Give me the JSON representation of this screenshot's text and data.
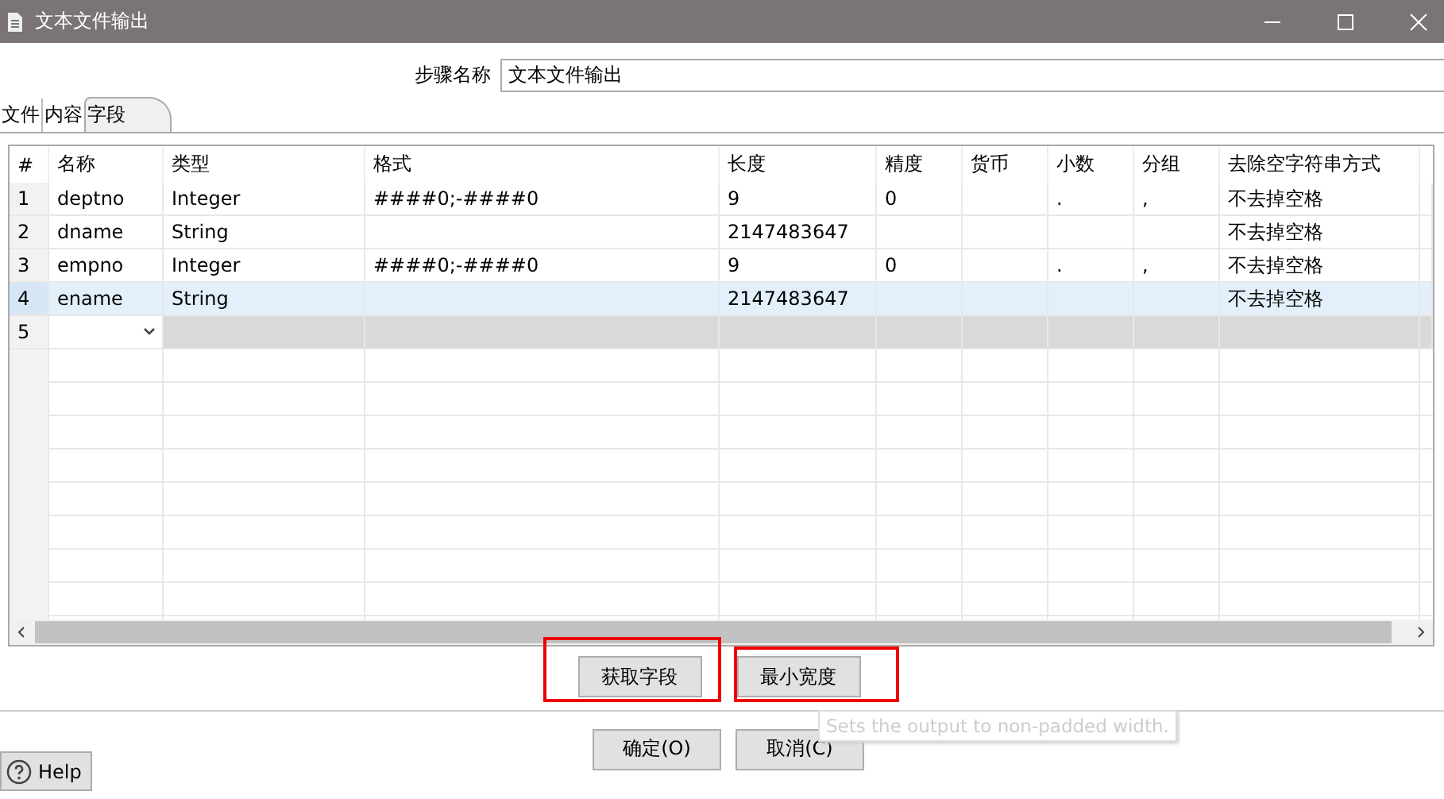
{
  "window": {
    "title": "文本文件输出"
  },
  "step_name": {
    "label": "步骤名称",
    "value": "文本文件输出"
  },
  "tabs": [
    {
      "label": "文件",
      "selected": false
    },
    {
      "label": "内容",
      "selected": false
    },
    {
      "label": "字段",
      "selected": true
    }
  ],
  "table": {
    "columns": [
      "#",
      "名称",
      "类型",
      "格式",
      "长度",
      "精度",
      "货币",
      "小数",
      "分组",
      "去除空字符串方式"
    ],
    "rows": [
      {
        "cells": [
          "1",
          "deptno",
          "Integer",
          "####0;-####0",
          "9",
          "0",
          null,
          ".",
          ",",
          "不去掉空格"
        ],
        "selected": false,
        "editing": false
      },
      {
        "cells": [
          "2",
          "dname",
          "String",
          null,
          "2147483647",
          null,
          null,
          null,
          null,
          "不去掉空格"
        ],
        "selected": false,
        "editing": false
      },
      {
        "cells": [
          "3",
          "empno",
          "Integer",
          "####0;-####0",
          "9",
          "0",
          null,
          ".",
          ",",
          "不去掉空格"
        ],
        "selected": false,
        "editing": false
      },
      {
        "cells": [
          "4",
          "ename",
          "String",
          null,
          "2147483647",
          null,
          null,
          null,
          null,
          "不去掉空格"
        ],
        "selected": true,
        "editing": false
      },
      {
        "cells": [
          "5",
          null,
          null,
          null,
          null,
          null,
          null,
          null,
          null,
          null
        ],
        "selected": false,
        "editing": true
      }
    ]
  },
  "table_buttons": [
    {
      "label": "获取字段",
      "highlighted": true
    },
    {
      "label": "最小宽度",
      "highlighted": true
    }
  ],
  "tooltip": "Sets the output to non-padded width.",
  "dialog_buttons": [
    "确定(O)",
    "取消(C)"
  ],
  "help_button": "Help"
}
